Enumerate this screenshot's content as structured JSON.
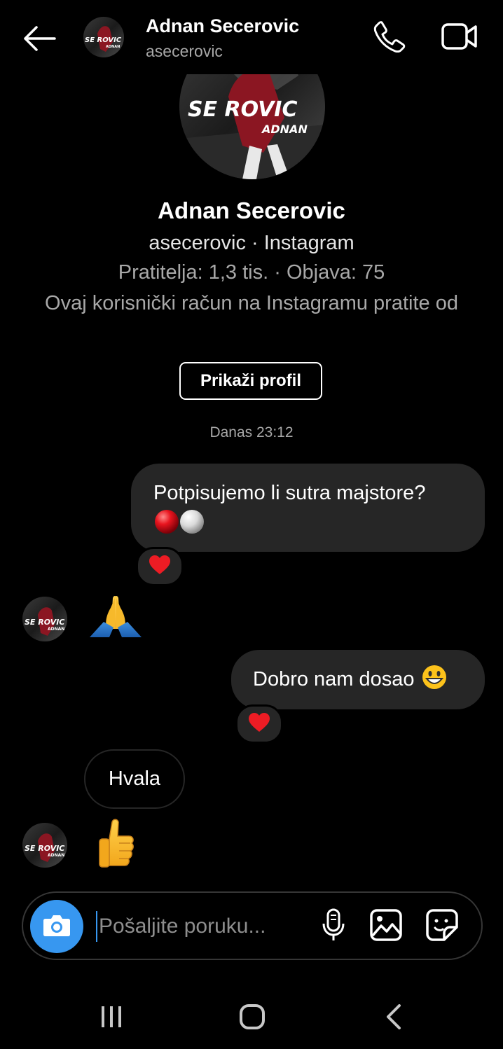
{
  "header": {
    "name": "Adnan Secerovic",
    "username": "asecerovic",
    "avatar_text": "SECEROVIC"
  },
  "profile": {
    "name": "Adnan Secerovic",
    "subtitle": "asecerovic · Instagram",
    "stats": "Pratitelja: 1,3 tis. · Objava: 75",
    "follow_note": "Ovaj korisnički račun na Instagramu pratite od",
    "view_profile_label": "Prikaži profil",
    "avatar_text": "SECEROVIC",
    "avatar_text_small": "ADNAN"
  },
  "conversation": {
    "timestamp": "Danas 23:12",
    "messages": [
      {
        "from": "me",
        "text": "Potpisujemo li sutra majstore?",
        "emoji": "red-ball, white-ball",
        "reaction": "red-heart"
      },
      {
        "from": "them",
        "emoji": "folded-hands"
      },
      {
        "from": "me",
        "text": "Dobro nam dosao",
        "emoji": "grinning-face",
        "reaction": "red-heart"
      },
      {
        "from": "them",
        "text": "Hvala"
      },
      {
        "from": "them",
        "emoji": "thumbs-up"
      }
    ]
  },
  "composer": {
    "placeholder": "Pošaljite poruku..."
  },
  "colors": {
    "background": "#000000",
    "bubble": "#262626",
    "accent": "#3797f0",
    "secondary_text": "#a8a8a8",
    "heart": "#ed1c24"
  },
  "icons": [
    "back-arrow-icon",
    "phone-icon",
    "video-camera-icon",
    "camera-icon",
    "microphone-icon",
    "gallery-icon",
    "sticker-icon",
    "recent-apps-icon",
    "home-icon",
    "nav-back-icon"
  ]
}
